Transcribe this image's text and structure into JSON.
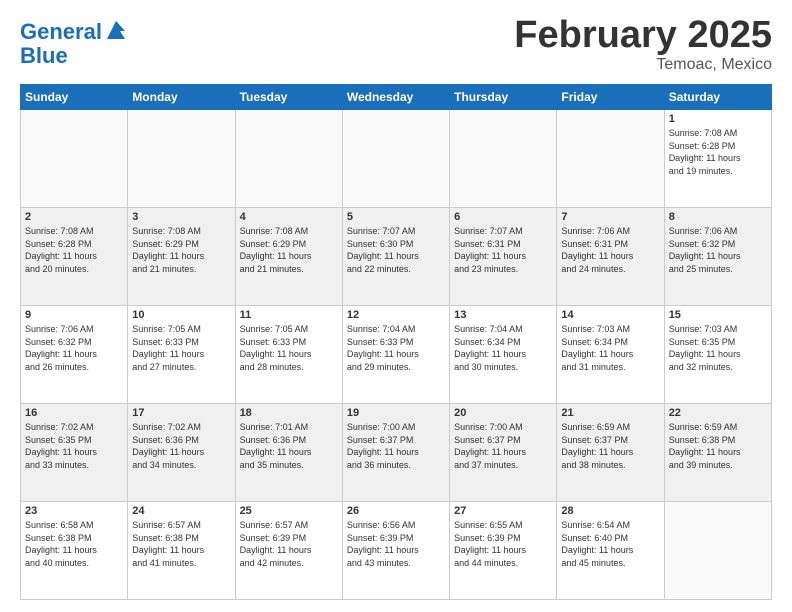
{
  "header": {
    "logo_line1": "General",
    "logo_line2": "Blue",
    "month": "February 2025",
    "location": "Temoac, Mexico"
  },
  "weekdays": [
    "Sunday",
    "Monday",
    "Tuesday",
    "Wednesday",
    "Thursday",
    "Friday",
    "Saturday"
  ],
  "weeks": [
    [
      {
        "day": "",
        "info": ""
      },
      {
        "day": "",
        "info": ""
      },
      {
        "day": "",
        "info": ""
      },
      {
        "day": "",
        "info": ""
      },
      {
        "day": "",
        "info": ""
      },
      {
        "day": "",
        "info": ""
      },
      {
        "day": "1",
        "info": "Sunrise: 7:08 AM\nSunset: 6:28 PM\nDaylight: 11 hours\nand 19 minutes."
      }
    ],
    [
      {
        "day": "2",
        "info": "Sunrise: 7:08 AM\nSunset: 6:28 PM\nDaylight: 11 hours\nand 20 minutes."
      },
      {
        "day": "3",
        "info": "Sunrise: 7:08 AM\nSunset: 6:29 PM\nDaylight: 11 hours\nand 21 minutes."
      },
      {
        "day": "4",
        "info": "Sunrise: 7:08 AM\nSunset: 6:29 PM\nDaylight: 11 hours\nand 21 minutes."
      },
      {
        "day": "5",
        "info": "Sunrise: 7:07 AM\nSunset: 6:30 PM\nDaylight: 11 hours\nand 22 minutes."
      },
      {
        "day": "6",
        "info": "Sunrise: 7:07 AM\nSunset: 6:31 PM\nDaylight: 11 hours\nand 23 minutes."
      },
      {
        "day": "7",
        "info": "Sunrise: 7:06 AM\nSunset: 6:31 PM\nDaylight: 11 hours\nand 24 minutes."
      },
      {
        "day": "8",
        "info": "Sunrise: 7:06 AM\nSunset: 6:32 PM\nDaylight: 11 hours\nand 25 minutes."
      }
    ],
    [
      {
        "day": "9",
        "info": "Sunrise: 7:06 AM\nSunset: 6:32 PM\nDaylight: 11 hours\nand 26 minutes."
      },
      {
        "day": "10",
        "info": "Sunrise: 7:05 AM\nSunset: 6:33 PM\nDaylight: 11 hours\nand 27 minutes."
      },
      {
        "day": "11",
        "info": "Sunrise: 7:05 AM\nSunset: 6:33 PM\nDaylight: 11 hours\nand 28 minutes."
      },
      {
        "day": "12",
        "info": "Sunrise: 7:04 AM\nSunset: 6:33 PM\nDaylight: 11 hours\nand 29 minutes."
      },
      {
        "day": "13",
        "info": "Sunrise: 7:04 AM\nSunset: 6:34 PM\nDaylight: 11 hours\nand 30 minutes."
      },
      {
        "day": "14",
        "info": "Sunrise: 7:03 AM\nSunset: 6:34 PM\nDaylight: 11 hours\nand 31 minutes."
      },
      {
        "day": "15",
        "info": "Sunrise: 7:03 AM\nSunset: 6:35 PM\nDaylight: 11 hours\nand 32 minutes."
      }
    ],
    [
      {
        "day": "16",
        "info": "Sunrise: 7:02 AM\nSunset: 6:35 PM\nDaylight: 11 hours\nand 33 minutes."
      },
      {
        "day": "17",
        "info": "Sunrise: 7:02 AM\nSunset: 6:36 PM\nDaylight: 11 hours\nand 34 minutes."
      },
      {
        "day": "18",
        "info": "Sunrise: 7:01 AM\nSunset: 6:36 PM\nDaylight: 11 hours\nand 35 minutes."
      },
      {
        "day": "19",
        "info": "Sunrise: 7:00 AM\nSunset: 6:37 PM\nDaylight: 11 hours\nand 36 minutes."
      },
      {
        "day": "20",
        "info": "Sunrise: 7:00 AM\nSunset: 6:37 PM\nDaylight: 11 hours\nand 37 minutes."
      },
      {
        "day": "21",
        "info": "Sunrise: 6:59 AM\nSunset: 6:37 PM\nDaylight: 11 hours\nand 38 minutes."
      },
      {
        "day": "22",
        "info": "Sunrise: 6:59 AM\nSunset: 6:38 PM\nDaylight: 11 hours\nand 39 minutes."
      }
    ],
    [
      {
        "day": "23",
        "info": "Sunrise: 6:58 AM\nSunset: 6:38 PM\nDaylight: 11 hours\nand 40 minutes."
      },
      {
        "day": "24",
        "info": "Sunrise: 6:57 AM\nSunset: 6:38 PM\nDaylight: 11 hours\nand 41 minutes."
      },
      {
        "day": "25",
        "info": "Sunrise: 6:57 AM\nSunset: 6:39 PM\nDaylight: 11 hours\nand 42 minutes."
      },
      {
        "day": "26",
        "info": "Sunrise: 6:56 AM\nSunset: 6:39 PM\nDaylight: 11 hours\nand 43 minutes."
      },
      {
        "day": "27",
        "info": "Sunrise: 6:55 AM\nSunset: 6:39 PM\nDaylight: 11 hours\nand 44 minutes."
      },
      {
        "day": "28",
        "info": "Sunrise: 6:54 AM\nSunset: 6:40 PM\nDaylight: 11 hours\nand 45 minutes."
      },
      {
        "day": "",
        "info": ""
      }
    ]
  ]
}
